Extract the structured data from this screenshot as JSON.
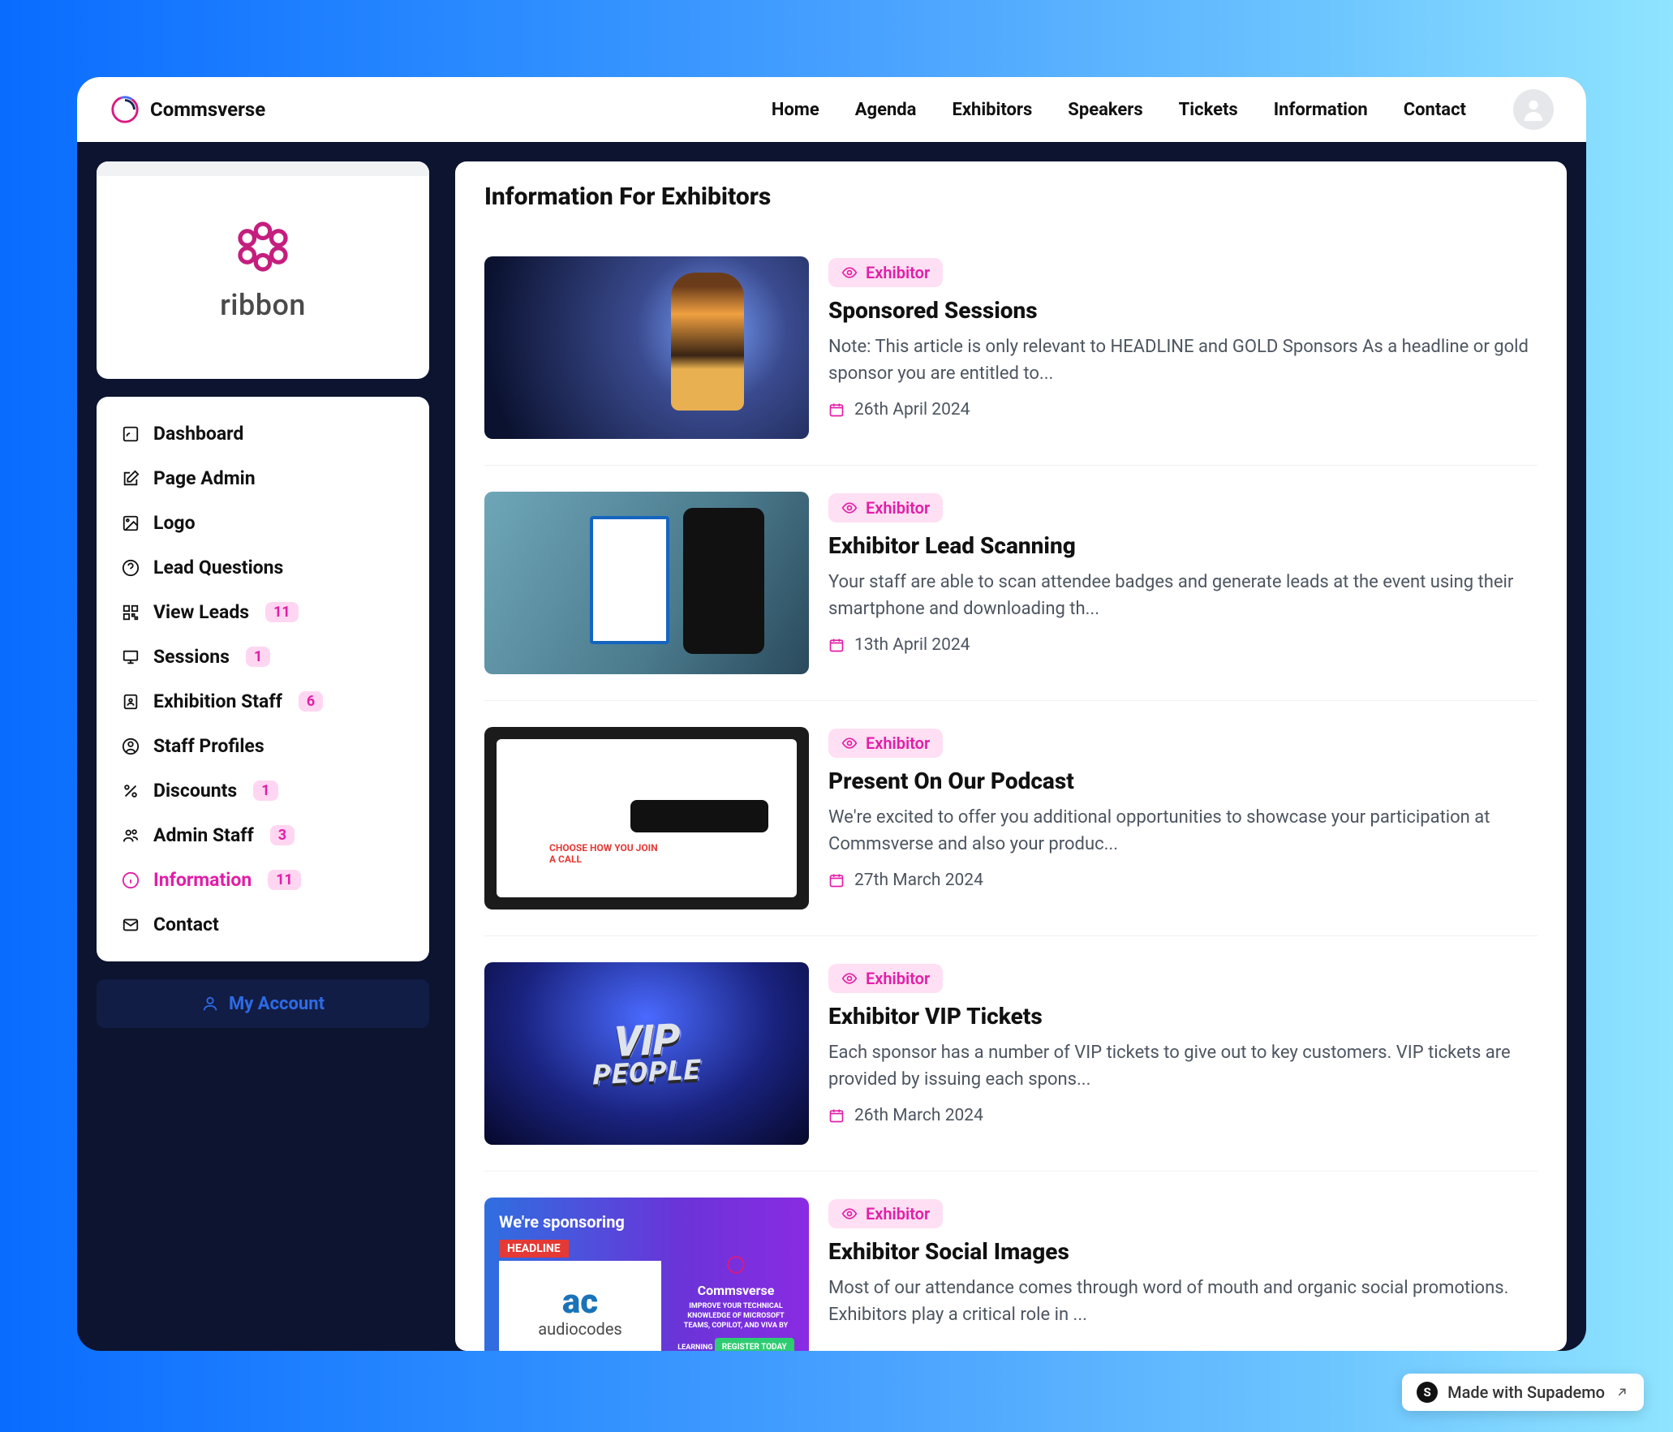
{
  "brand": "Commsverse",
  "nav": [
    "Home",
    "Agenda",
    "Exhibitors",
    "Speakers",
    "Tickets",
    "Information",
    "Contact"
  ],
  "sidebar": {
    "logo_text": "ribbon",
    "items": [
      {
        "label": "Dashboard"
      },
      {
        "label": "Page Admin"
      },
      {
        "label": "Logo"
      },
      {
        "label": "Lead Questions"
      },
      {
        "label": "View Leads",
        "badge": "11"
      },
      {
        "label": "Sessions",
        "badge": "1"
      },
      {
        "label": "Exhibition Staff",
        "badge": "6"
      },
      {
        "label": "Staff Profiles"
      },
      {
        "label": "Discounts",
        "badge": "1"
      },
      {
        "label": "Admin Staff",
        "badge": "3"
      },
      {
        "label": "Information",
        "badge": "11",
        "active": true
      },
      {
        "label": "Contact"
      }
    ],
    "account_button": "My Account"
  },
  "page": {
    "title": "Information For Exhibitors",
    "tag_label": "Exhibitor",
    "articles": [
      {
        "title": "Sponsored Sessions",
        "desc": "Note: This article is only relevant to HEADLINE and GOLD Sponsors As a headline or gold sponsor you are entitled to...",
        "date": "26th April 2024"
      },
      {
        "title": "Exhibitor Lead Scanning",
        "desc": "Your staff are able to scan attendee badges and generate leads at the event using their smartphone and downloading th...",
        "date": "13th April 2024"
      },
      {
        "title": "Present On Our Podcast",
        "desc": "We're excited to offer you additional opportunities to showcase your participation at Commsverse and also your produc...",
        "date": "27th March 2024"
      },
      {
        "title": "Exhibitor VIP Tickets",
        "desc": "Each sponsor has a number of VIP tickets to give out to key customers. VIP tickets are provided by issuing each spons...",
        "date": "26th March 2024"
      },
      {
        "title": "Exhibitor Social Images",
        "desc": "Most of our attendance comes through word of mouth and organic social promotions. Exhibitors play a critical role in ...",
        "date": ""
      }
    ]
  },
  "thumb5": {
    "sponsoring": "We're sponsoring",
    "headline": "HEADLINE",
    "ac": "ac",
    "ac_word": "audiocodes",
    "cv": "Commsverse",
    "reg": "REGISTER TODAY"
  },
  "footer": {
    "supademo": "Made with Supademo"
  }
}
